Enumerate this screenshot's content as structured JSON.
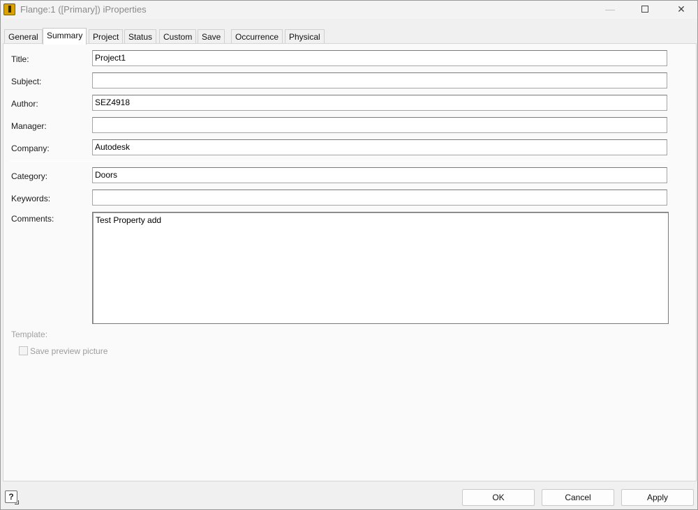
{
  "window": {
    "title": "Flange:1 ([Primary]) iProperties"
  },
  "tabs": [
    {
      "label": "General",
      "active": false
    },
    {
      "label": "Summary",
      "active": true
    },
    {
      "label": "Project",
      "active": false
    },
    {
      "label": "Status",
      "active": false
    },
    {
      "label": "Custom",
      "active": false
    },
    {
      "label": "Save",
      "active": false
    },
    {
      "label": "Occurrence",
      "active": false
    },
    {
      "label": "Physical",
      "active": false
    }
  ],
  "summary": {
    "title": {
      "label": "Title:",
      "value": "Project1"
    },
    "subject": {
      "label": "Subject:",
      "value": ""
    },
    "author": {
      "label": "Author:",
      "value": "SEZ4918"
    },
    "manager": {
      "label": "Manager:",
      "value": ""
    },
    "company": {
      "label": "Company:",
      "value": "Autodesk"
    },
    "category": {
      "label": "Category:",
      "value": "Doors"
    },
    "keywords": {
      "label": "Keywords:",
      "value": ""
    },
    "comments": {
      "label": "Comments:",
      "value": "Test Property add"
    },
    "template": {
      "label": "Template:"
    },
    "save_preview": {
      "label": "Save preview picture",
      "checked": false,
      "enabled": false
    }
  },
  "footer": {
    "help_icon": "help-question-icon",
    "ok_label": "OK",
    "cancel_label": "Cancel",
    "apply_label": "Apply"
  }
}
